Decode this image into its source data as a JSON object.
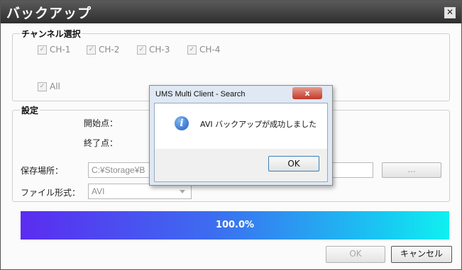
{
  "window": {
    "title": "バックアップ",
    "close_icon": "close-icon"
  },
  "channels": {
    "legend": "チャンネル選択",
    "items": [
      "CH-1",
      "CH-2",
      "CH-3",
      "CH-4"
    ],
    "all": "All"
  },
  "settings": {
    "legend": "設定",
    "start_label": "開始点：",
    "end_label": "終了点：",
    "save_label": "保存場所：",
    "save_value": "C:¥Storage¥B",
    "browse_label": "...",
    "format_label": "ファイル形式：",
    "format_value": "AVI"
  },
  "progress": {
    "value": 100.0,
    "text": "100.0%"
  },
  "buttons": {
    "ok": "OK",
    "cancel": "キャンセル"
  },
  "dialog": {
    "title": "UMS Multi Client - Search",
    "close": "x",
    "message": "AVI バックアップが成功しました",
    "ok": "OK"
  },
  "colors": {
    "progress_start": "#5b2cf0",
    "progress_end": "#10f0f0",
    "titlebar": "#3a3a3a"
  }
}
